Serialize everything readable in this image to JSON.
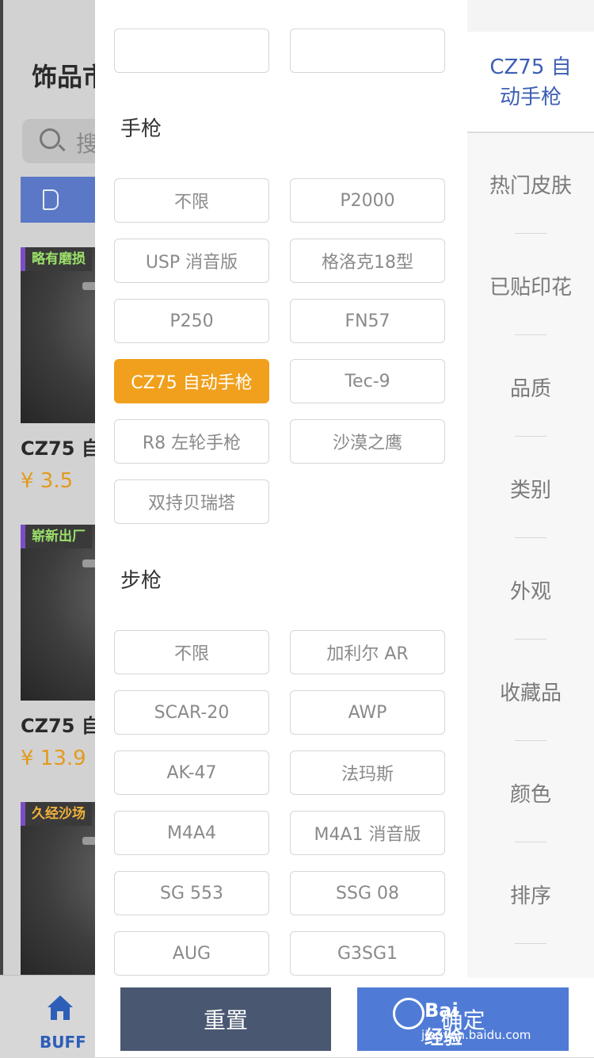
{
  "background": {
    "title": "饰品市",
    "search_placeholder": "搜",
    "items": [
      {
        "wear": "略有磨损",
        "name": "CZ75 自",
        "price": "¥ 3.5"
      },
      {
        "wear": "崭新出厂",
        "name": "CZ75 自",
        "price": "¥ 13.9"
      },
      {
        "wear": "久经沙场"
      }
    ],
    "tabbar": {
      "home_label": "BUFF"
    }
  },
  "drawer": {
    "pistol_section": {
      "title": "手枪",
      "options": [
        "不限",
        "P2000",
        "USP 消音版",
        "格洛克18型",
        "P250",
        "FN57",
        "CZ75 自动手枪",
        "Tec-9",
        "R8 左轮手枪",
        "沙漠之鹰",
        "双持贝瑞塔"
      ],
      "selected": "CZ75 自动手枪"
    },
    "rifle_section": {
      "title": "步枪",
      "options": [
        "不限",
        "加利尔 AR",
        "SCAR-20",
        "AWP",
        "AK-47",
        "法玛斯",
        "M4A4",
        "M4A1 消音版",
        "SG 553",
        "SSG 08",
        "AUG",
        "G3SG1"
      ]
    },
    "side_nav": {
      "active": "CZ75 自动手枪",
      "active_lines": [
        "CZ75 自",
        "动手枪"
      ],
      "items": [
        "热门皮肤",
        "已贴印花",
        "品质",
        "类别",
        "外观",
        "收藏品",
        "颜色",
        "排序"
      ]
    },
    "footer": {
      "reset_label": "重置",
      "confirm_label": "确定"
    }
  },
  "watermark": {
    "text": "Bai经验",
    "url": "jingyan.baidu.com"
  },
  "colors": {
    "accent_selected": "#f0a01c",
    "active_nav_text": "#3d5fb4",
    "reset_bg": "#4a5771",
    "confirm_bg": "#4f7bd6"
  }
}
